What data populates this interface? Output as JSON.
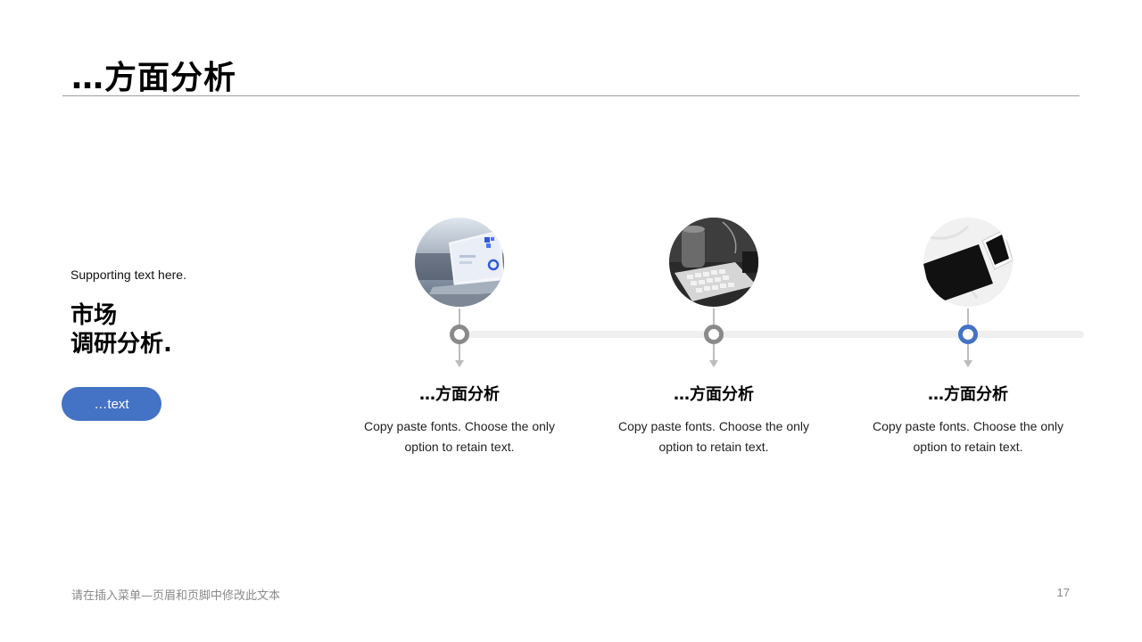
{
  "slide": {
    "title": "…方面分析",
    "page_number": "17",
    "footer": "请在插入菜单—页眉和页脚中修改此文本"
  },
  "left_panel": {
    "supporting_text": "Supporting text here.",
    "headline_line1": "市场",
    "headline_line2": "调研分析.",
    "button_label": "…text"
  },
  "timeline": {
    "accent_color": "#4472c4",
    "node_color": "#8a8a8a",
    "steps": [
      {
        "title": "…方面分析",
        "description": "Copy paste fonts. Choose the only option to retain text.",
        "image": "laptop-dashboard-photo",
        "active": false
      },
      {
        "title": "…方面分析",
        "description": "Copy paste fonts. Choose the only option to retain text.",
        "image": "keyboard-desk-photo",
        "active": false
      },
      {
        "title": "…方面分析",
        "description": "Copy paste fonts. Choose the only option to retain text.",
        "image": "smartphone-desk-photo",
        "active": true
      }
    ]
  }
}
